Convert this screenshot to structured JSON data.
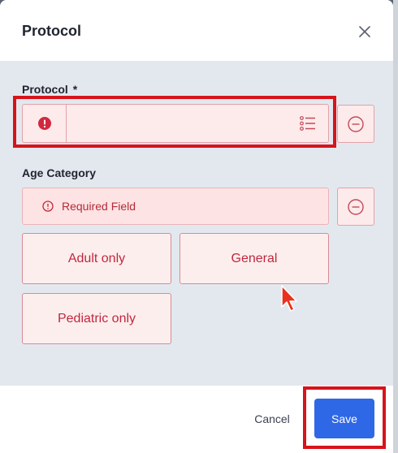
{
  "dialog": {
    "title": "Protocol",
    "close_icon": "close-icon"
  },
  "protocol_field": {
    "label": "Protocol",
    "required_marker": "*",
    "value": "",
    "error_icon": "error-filled-icon",
    "list_icon": "list-icon",
    "remove_icon": "minus-circle-icon"
  },
  "age_category": {
    "label": "Age Category",
    "error_text": "Required Field",
    "error_icon": "alert-circle-icon",
    "remove_icon": "minus-circle-icon",
    "options": [
      "Adult only",
      "General",
      "Pediatric only"
    ]
  },
  "footer": {
    "cancel_label": "Cancel",
    "save_label": "Save"
  },
  "colors": {
    "error_text": "#c0283d",
    "error_bg": "#fdeaea",
    "body_bg": "#e3e8ef",
    "primary": "#2f68e6",
    "highlight": "#d7141a"
  }
}
